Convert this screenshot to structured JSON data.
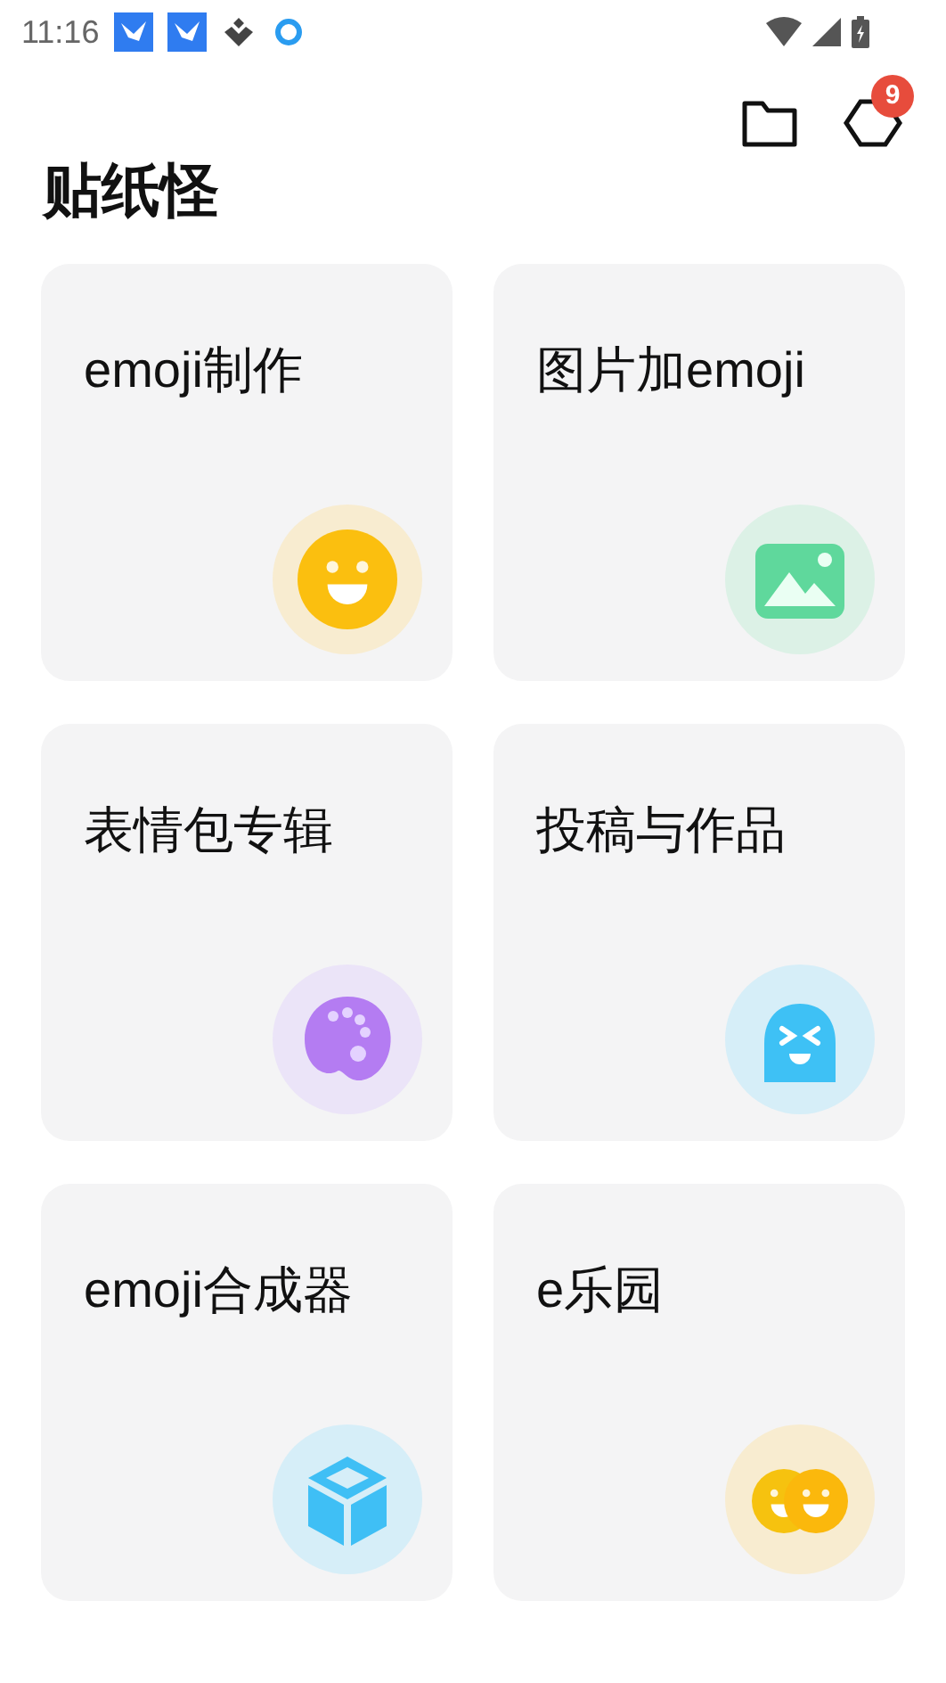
{
  "status_bar": {
    "time": "11:16"
  },
  "header": {
    "badge": "9"
  },
  "title": "贴纸怪",
  "cards": [
    {
      "label": "emoji制作",
      "kind": "smiley"
    },
    {
      "label": "图片加emoji",
      "kind": "image"
    },
    {
      "label": "表情包专辑",
      "kind": "palette"
    },
    {
      "label": "投稿与作品",
      "kind": "ghost"
    },
    {
      "label": "emoji合成器",
      "kind": "cube"
    },
    {
      "label": "e乐园",
      "kind": "pair"
    }
  ]
}
